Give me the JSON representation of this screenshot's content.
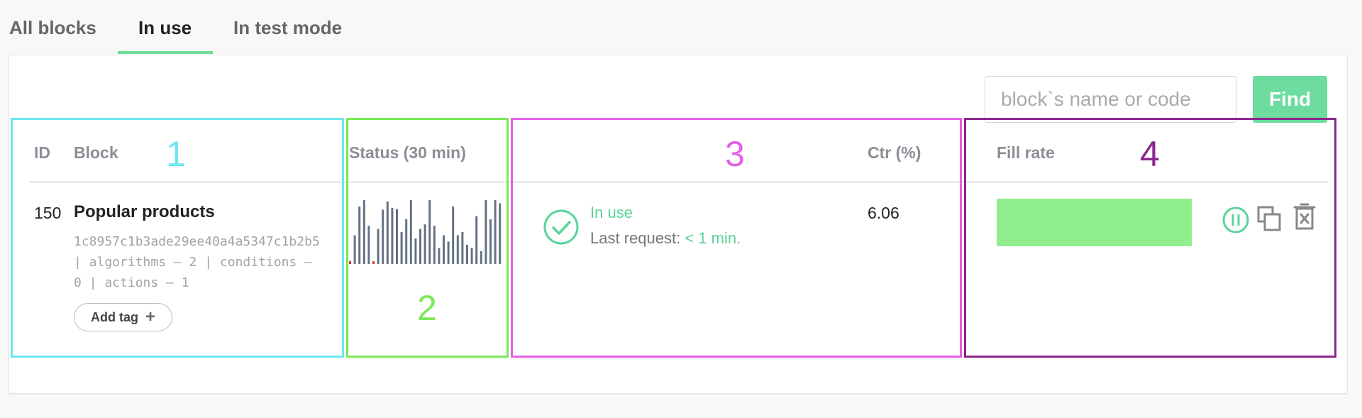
{
  "tabs": [
    {
      "label": "All blocks",
      "active": false
    },
    {
      "label": "In use",
      "active": true
    },
    {
      "label": "In test mode",
      "active": false
    }
  ],
  "search": {
    "placeholder": "block`s name or code",
    "value": "",
    "button_label": "Find"
  },
  "table": {
    "headers": {
      "id": "ID",
      "block": "Block",
      "status": "Status (30 min)",
      "ctr": "Ctr (%)",
      "fill_rate": "Fill rate"
    },
    "rows": [
      {
        "id": "150",
        "block_name": "Popular products",
        "code_line1": "1c8957c1b3ade29ee40a4a5347c1b2b5",
        "code_line2": "| algorithms – 2 | conditions –",
        "code_line3": "0 | actions – 1",
        "add_tag_label": "Add tag",
        "status_sparkline": [
          0.02,
          0.45,
          0.9,
          1.0,
          0.6,
          0.01,
          0.55,
          0.85,
          0.98,
          0.88,
          0.86,
          0.5,
          0.7,
          1.0,
          0.4,
          0.55,
          0.62,
          1.0,
          0.6,
          0.25,
          0.45,
          0.35,
          0.9,
          0.45,
          0.5,
          0.3,
          0.25,
          0.75,
          0.2,
          1.0,
          0.7,
          1.0,
          0.95
        ],
        "sparkline_error_indices": [
          0,
          5
        ],
        "status_text": "In use",
        "last_request_label": "Last request:",
        "last_request_value": "< 1 min.",
        "ctr": "6.06",
        "fill_rate_fraction": 1.0
      }
    ]
  },
  "annotations": [
    "1",
    "2",
    "3",
    "4"
  ],
  "colors": {
    "accent": "#6ddc9f",
    "status_green": "#5ad49a",
    "fill_bar": "#91ee8d",
    "sparkline_bar": "#647282",
    "sparkline_error": "#e0392d",
    "region1": "#6ce8ee",
    "region2": "#7ce85a",
    "region3": "#e560e6",
    "region4": "#8b268e"
  },
  "icons": [
    "check-circle-icon",
    "pause-circle-icon",
    "copy-icon",
    "delete-icon",
    "plus-icon"
  ]
}
